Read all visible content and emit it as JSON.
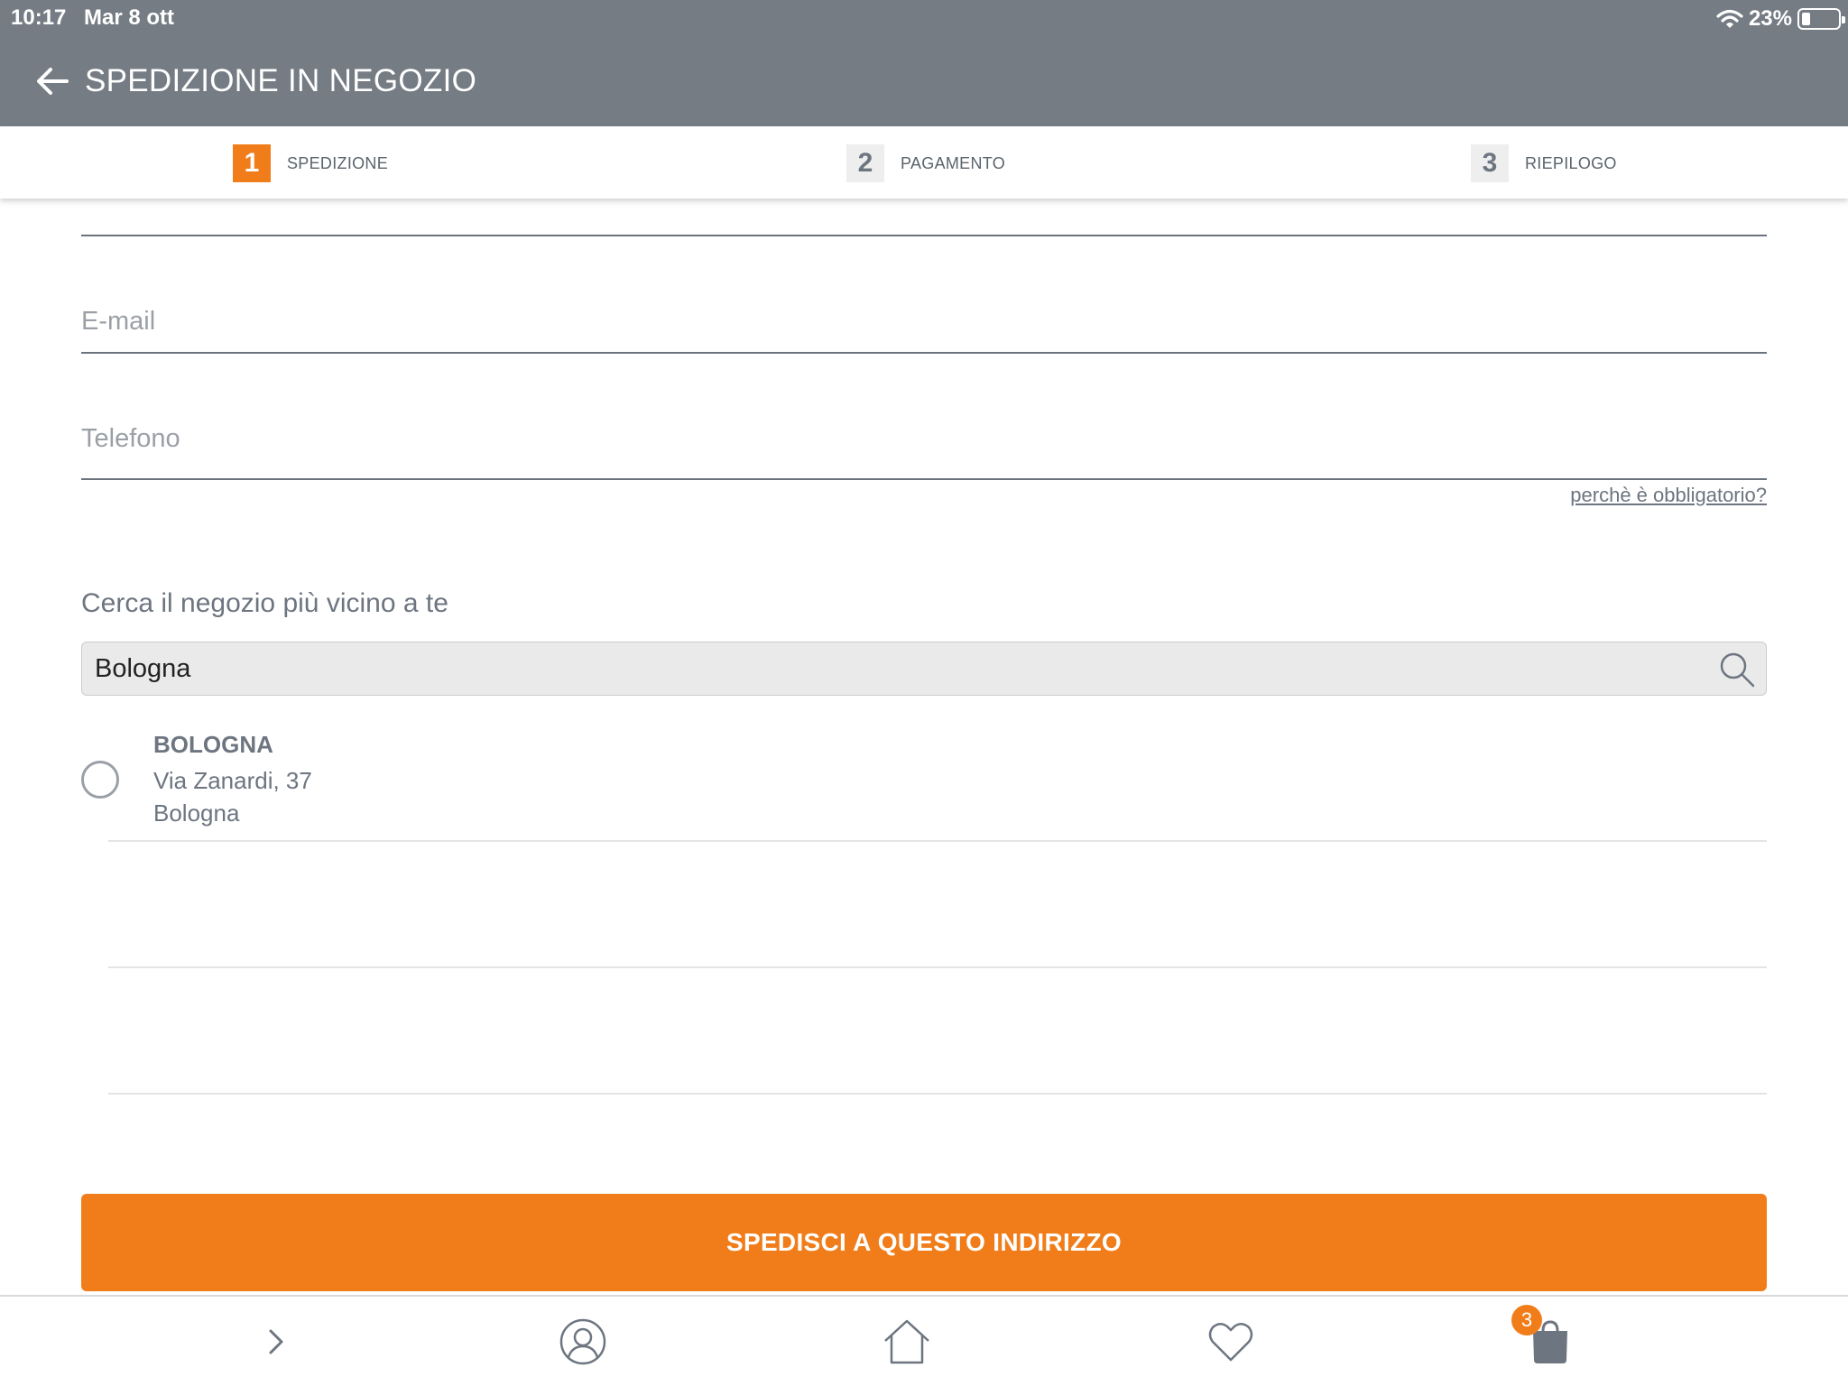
{
  "status_bar": {
    "time": "10:17",
    "date": "Mar 8 ott",
    "battery": "23%",
    "battery_level": 0.23
  },
  "header": {
    "title": "SPEDIZIONE IN NEGOZIO"
  },
  "steps": [
    {
      "number": "1",
      "label": "SPEDIZIONE",
      "active": true
    },
    {
      "number": "2",
      "label": "PAGAMENTO",
      "active": false
    },
    {
      "number": "3",
      "label": "RIEPILOGO",
      "active": false
    }
  ],
  "form": {
    "email_placeholder": "E-mail",
    "phone_placeholder": "Telefono",
    "why_required_link": "perchè è obbligatorio?"
  },
  "store_search": {
    "title": "Cerca il negozio più vicino a te",
    "query": "Bologna"
  },
  "stores": [
    {
      "name": "BOLOGNA",
      "address": "Via Zanardi, 37",
      "city": "Bologna",
      "selected": false
    }
  ],
  "cta": {
    "label": "SPEDISCI A QUESTO INDIRIZZO"
  },
  "tab_bar": {
    "items": [
      "chevron-right-icon",
      "account-icon",
      "home-icon",
      "heart-icon",
      "shopping-bag-icon"
    ],
    "cart_badge": "3"
  },
  "colors": {
    "header_bg": "#757c84",
    "accent": "#f07d1a",
    "text": "#6d7580"
  }
}
